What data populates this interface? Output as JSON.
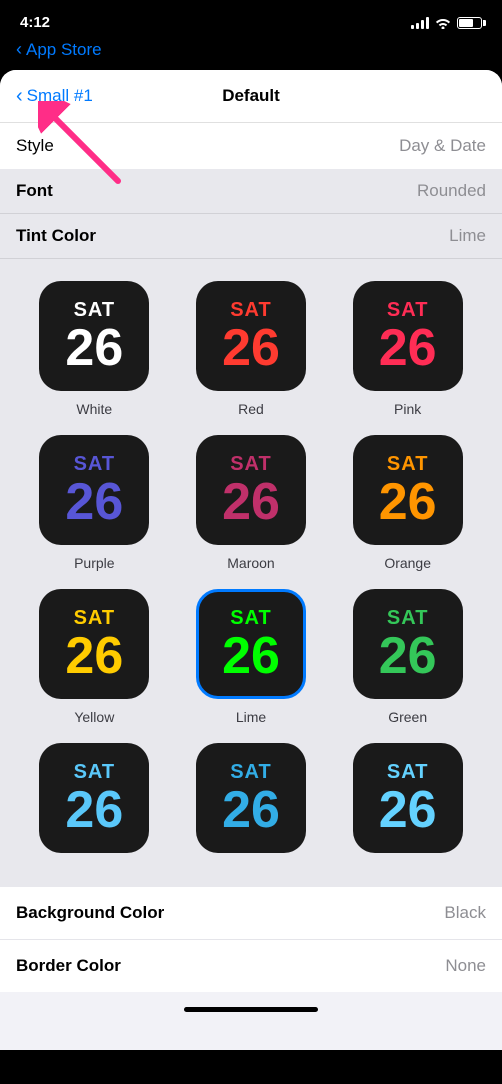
{
  "statusBar": {
    "time": "4:12",
    "backLabel": "App Store"
  },
  "nav": {
    "backLabel": "Small #1",
    "title": "Default"
  },
  "settings": {
    "styleLabel": "Style",
    "styleValue": "Day & Date",
    "fontLabel": "Font",
    "fontValue": "Rounded",
    "tintColorLabel": "Tint Color",
    "tintColorValue": "Lime",
    "backgroundColorLabel": "Background Color",
    "backgroundColorValue": "Black",
    "borderColorLabel": "Border Color",
    "borderColorValue": "None"
  },
  "colorOptions": [
    {
      "id": "white",
      "name": "White",
      "dayColor": "#ffffff",
      "numColor": "#ffffff",
      "selected": false
    },
    {
      "id": "red",
      "name": "Red",
      "dayColor": "#ff3b30",
      "numColor": "#ff3b30",
      "selected": false
    },
    {
      "id": "pink",
      "name": "Pink",
      "dayColor": "#ff2d55",
      "numColor": "#ff2d55",
      "selected": false
    },
    {
      "id": "purple",
      "name": "Purple",
      "dayColor": "#5856d6",
      "numColor": "#5856d6",
      "selected": false
    },
    {
      "id": "maroon",
      "name": "Maroon",
      "dayColor": "#c0306a",
      "numColor": "#c0306a",
      "selected": false
    },
    {
      "id": "orange",
      "name": "Orange",
      "dayColor": "#ff9500",
      "numColor": "#ff9500",
      "selected": false
    },
    {
      "id": "yellow",
      "name": "Yellow",
      "dayColor": "#ffcc00",
      "numColor": "#ffcc00",
      "selected": false
    },
    {
      "id": "lime",
      "name": "Lime",
      "dayColor": "#00ff00",
      "numColor": "#00ff00",
      "selected": true
    },
    {
      "id": "green",
      "name": "Green",
      "dayColor": "#34c759",
      "numColor": "#34c759",
      "selected": false
    },
    {
      "id": "teal1",
      "name": "",
      "dayColor": "#5ac8fa",
      "numColor": "#5ac8fa",
      "selected": false
    },
    {
      "id": "teal2",
      "name": "",
      "dayColor": "#32ade6",
      "numColor": "#32ade6",
      "selected": false
    },
    {
      "id": "cyan",
      "name": "",
      "dayColor": "#64d2ff",
      "numColor": "#64d2ff",
      "selected": false
    }
  ],
  "watchDay": "SAT",
  "watchNum": "26"
}
